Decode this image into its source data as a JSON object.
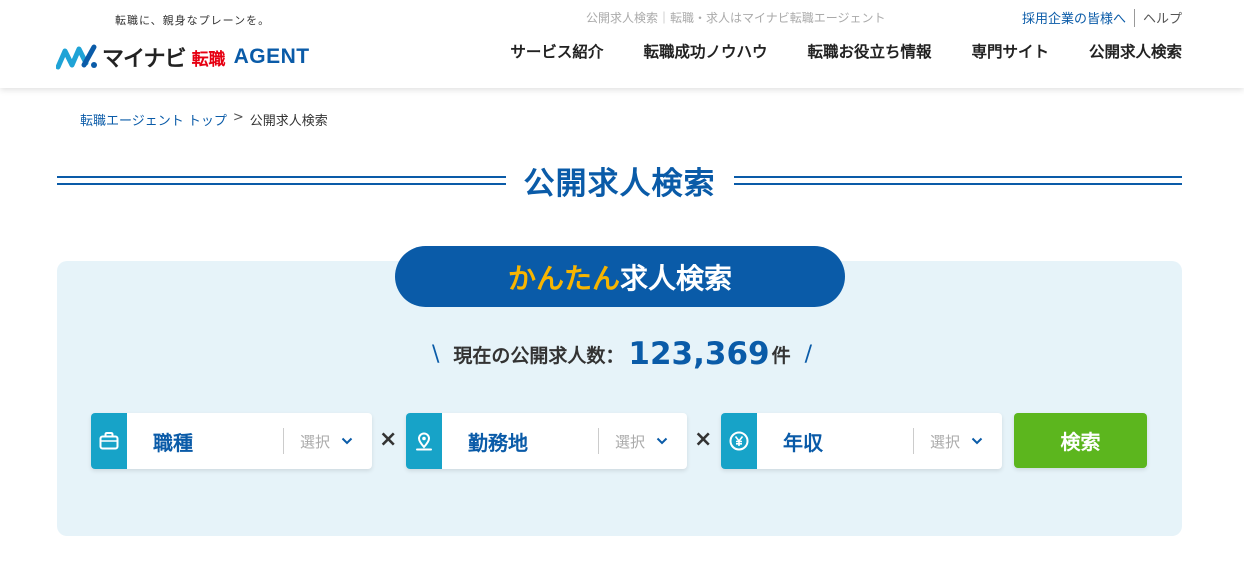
{
  "header": {
    "tagline": "転職に、親身なプレーンを。",
    "logo": {
      "name": "マイナビ",
      "tenshoku": "転職",
      "agent": "AGENT"
    },
    "caption": "公開求人検索｜転職・求人はマイナビ転職エージェント",
    "util_links": {
      "employers": "採用企業の皆様へ",
      "help": "ヘルプ"
    },
    "nav": [
      {
        "label": "サービス紹介"
      },
      {
        "label": "転職成功ノウハウ"
      },
      {
        "label": "転職お役立ち情報"
      },
      {
        "label": "専門サイト"
      },
      {
        "label": "公開求人検索"
      }
    ]
  },
  "breadcrumb": {
    "top": "転職エージェント トップ",
    "sep": ">",
    "current": "公開求人検索"
  },
  "page_title": "公開求人検索",
  "search": {
    "badge_accent": "かんたん",
    "badge_rest": "求人検索",
    "count_label": "現在の公開求人数：",
    "count_value": "123,369",
    "count_unit": "件",
    "slash_left": "\\",
    "slash_right": "/",
    "times": "×",
    "selectors": [
      {
        "label": "職種",
        "placeholder": "選択",
        "icon": "briefcase-icon"
      },
      {
        "label": "勤務地",
        "placeholder": "選択",
        "icon": "map-pin-icon"
      },
      {
        "label": "年収",
        "placeholder": "選択",
        "icon": "yen-icon"
      }
    ],
    "button_label": "検索"
  },
  "colors": {
    "brand_blue": "#0a5ba8",
    "accent_yellow": "#f8b500",
    "icon_teal": "#17a3c8",
    "button_green": "#5cb61e",
    "panel_bg": "#e6f3f9"
  }
}
